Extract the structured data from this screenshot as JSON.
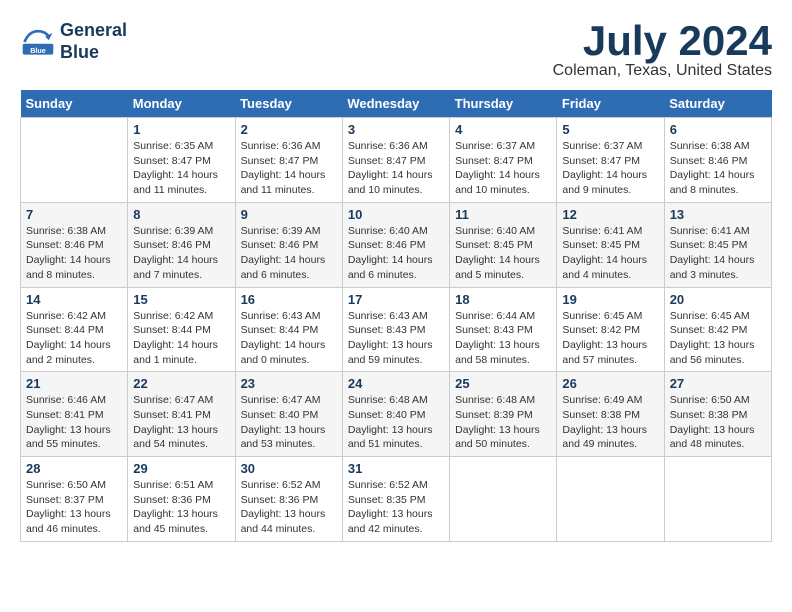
{
  "header": {
    "logo_line1": "General",
    "logo_line2": "Blue",
    "month_title": "July 2024",
    "location": "Coleman, Texas, United States"
  },
  "calendar": {
    "days_of_week": [
      "Sunday",
      "Monday",
      "Tuesday",
      "Wednesday",
      "Thursday",
      "Friday",
      "Saturday"
    ],
    "weeks": [
      [
        {
          "day": "",
          "info": ""
        },
        {
          "day": "1",
          "info": "Sunrise: 6:35 AM\nSunset: 8:47 PM\nDaylight: 14 hours\nand 11 minutes."
        },
        {
          "day": "2",
          "info": "Sunrise: 6:36 AM\nSunset: 8:47 PM\nDaylight: 14 hours\nand 11 minutes."
        },
        {
          "day": "3",
          "info": "Sunrise: 6:36 AM\nSunset: 8:47 PM\nDaylight: 14 hours\nand 10 minutes."
        },
        {
          "day": "4",
          "info": "Sunrise: 6:37 AM\nSunset: 8:47 PM\nDaylight: 14 hours\nand 10 minutes."
        },
        {
          "day": "5",
          "info": "Sunrise: 6:37 AM\nSunset: 8:47 PM\nDaylight: 14 hours\nand 9 minutes."
        },
        {
          "day": "6",
          "info": "Sunrise: 6:38 AM\nSunset: 8:46 PM\nDaylight: 14 hours\nand 8 minutes."
        }
      ],
      [
        {
          "day": "7",
          "info": "Sunrise: 6:38 AM\nSunset: 8:46 PM\nDaylight: 14 hours\nand 8 minutes."
        },
        {
          "day": "8",
          "info": "Sunrise: 6:39 AM\nSunset: 8:46 PM\nDaylight: 14 hours\nand 7 minutes."
        },
        {
          "day": "9",
          "info": "Sunrise: 6:39 AM\nSunset: 8:46 PM\nDaylight: 14 hours\nand 6 minutes."
        },
        {
          "day": "10",
          "info": "Sunrise: 6:40 AM\nSunset: 8:46 PM\nDaylight: 14 hours\nand 6 minutes."
        },
        {
          "day": "11",
          "info": "Sunrise: 6:40 AM\nSunset: 8:45 PM\nDaylight: 14 hours\nand 5 minutes."
        },
        {
          "day": "12",
          "info": "Sunrise: 6:41 AM\nSunset: 8:45 PM\nDaylight: 14 hours\nand 4 minutes."
        },
        {
          "day": "13",
          "info": "Sunrise: 6:41 AM\nSunset: 8:45 PM\nDaylight: 14 hours\nand 3 minutes."
        }
      ],
      [
        {
          "day": "14",
          "info": "Sunrise: 6:42 AM\nSunset: 8:44 PM\nDaylight: 14 hours\nand 2 minutes."
        },
        {
          "day": "15",
          "info": "Sunrise: 6:42 AM\nSunset: 8:44 PM\nDaylight: 14 hours\nand 1 minute."
        },
        {
          "day": "16",
          "info": "Sunrise: 6:43 AM\nSunset: 8:44 PM\nDaylight: 14 hours\nand 0 minutes."
        },
        {
          "day": "17",
          "info": "Sunrise: 6:43 AM\nSunset: 8:43 PM\nDaylight: 13 hours\nand 59 minutes."
        },
        {
          "day": "18",
          "info": "Sunrise: 6:44 AM\nSunset: 8:43 PM\nDaylight: 13 hours\nand 58 minutes."
        },
        {
          "day": "19",
          "info": "Sunrise: 6:45 AM\nSunset: 8:42 PM\nDaylight: 13 hours\nand 57 minutes."
        },
        {
          "day": "20",
          "info": "Sunrise: 6:45 AM\nSunset: 8:42 PM\nDaylight: 13 hours\nand 56 minutes."
        }
      ],
      [
        {
          "day": "21",
          "info": "Sunrise: 6:46 AM\nSunset: 8:41 PM\nDaylight: 13 hours\nand 55 minutes."
        },
        {
          "day": "22",
          "info": "Sunrise: 6:47 AM\nSunset: 8:41 PM\nDaylight: 13 hours\nand 54 minutes."
        },
        {
          "day": "23",
          "info": "Sunrise: 6:47 AM\nSunset: 8:40 PM\nDaylight: 13 hours\nand 53 minutes."
        },
        {
          "day": "24",
          "info": "Sunrise: 6:48 AM\nSunset: 8:40 PM\nDaylight: 13 hours\nand 51 minutes."
        },
        {
          "day": "25",
          "info": "Sunrise: 6:48 AM\nSunset: 8:39 PM\nDaylight: 13 hours\nand 50 minutes."
        },
        {
          "day": "26",
          "info": "Sunrise: 6:49 AM\nSunset: 8:38 PM\nDaylight: 13 hours\nand 49 minutes."
        },
        {
          "day": "27",
          "info": "Sunrise: 6:50 AM\nSunset: 8:38 PM\nDaylight: 13 hours\nand 48 minutes."
        }
      ],
      [
        {
          "day": "28",
          "info": "Sunrise: 6:50 AM\nSunset: 8:37 PM\nDaylight: 13 hours\nand 46 minutes."
        },
        {
          "day": "29",
          "info": "Sunrise: 6:51 AM\nSunset: 8:36 PM\nDaylight: 13 hours\nand 45 minutes."
        },
        {
          "day": "30",
          "info": "Sunrise: 6:52 AM\nSunset: 8:36 PM\nDaylight: 13 hours\nand 44 minutes."
        },
        {
          "day": "31",
          "info": "Sunrise: 6:52 AM\nSunset: 8:35 PM\nDaylight: 13 hours\nand 42 minutes."
        },
        {
          "day": "",
          "info": ""
        },
        {
          "day": "",
          "info": ""
        },
        {
          "day": "",
          "info": ""
        }
      ]
    ]
  }
}
